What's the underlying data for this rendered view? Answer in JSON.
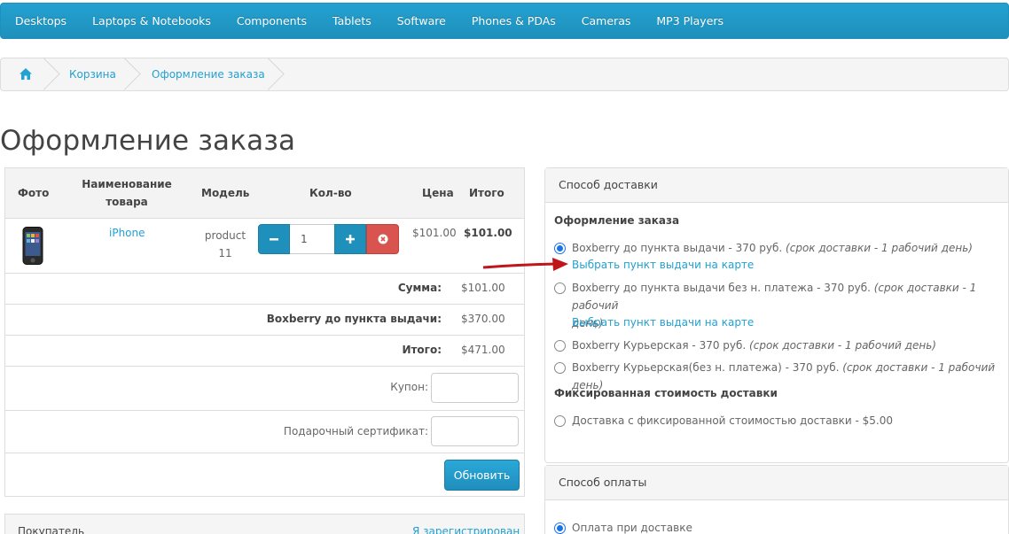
{
  "nav": [
    "Desktops",
    "Laptops & Notebooks",
    "Components",
    "Tablets",
    "Software",
    "Phones & PDAs",
    "Cameras",
    "MP3 Players"
  ],
  "breadcrumb": {
    "home_icon": "home-icon",
    "items": [
      "Корзина",
      "Оформление заказа"
    ]
  },
  "page_title": "Оформление заказа",
  "cart": {
    "headers": {
      "photo": "Фото",
      "name": "Наименование товара",
      "model": "Модель",
      "qty": "Кол-во",
      "price": "Цена",
      "total": "Итого"
    },
    "item": {
      "name": "iPhone",
      "model": "product 11",
      "qty": "1",
      "price": "$101.00",
      "total": "$101.00"
    },
    "summary": [
      {
        "label": "Сумма:",
        "value": "$101.00"
      },
      {
        "label": "Boxberry до пункта выдачи:",
        "value": "$370.00"
      },
      {
        "label": "Итого:",
        "value": "$471.00"
      }
    ],
    "coupon_label": "Купон:",
    "gift_label": "Подарочный сертификат:",
    "update_button": "Обновить"
  },
  "buyer_panel": {
    "title": "Покупатель",
    "link": "Я зарегистрирован"
  },
  "delivery": {
    "title": "Способ доставки",
    "section1": "Оформление заказа",
    "options": [
      {
        "text": "Boxberry до пункта выдачи - 370 руб. ",
        "note": "(срок доставки - 1 рабочий день)",
        "selected": true
      },
      {
        "text": "Boxberry до пункта выдачи без н. платежа - 370 руб. ",
        "note": "(срок доставки - 1 рабочий",
        "note2": "день)",
        "selected": false
      },
      {
        "text": "Boxberry Курьерская - 370 руб. ",
        "note": "(срок доставки - 1 рабочий день)",
        "selected": false
      },
      {
        "text": "Boxberry Курьерская(без н. платежа) - 370 руб. ",
        "note": "(срок доставки - 1 рабочий день)",
        "selected": false
      }
    ],
    "map_link": "Выбрать пункт выдачи на карте",
    "section2": "Фиксированная стоимость доставки",
    "fixed_option": "Доставка с фиксированной стоимостью доставки - $5.00"
  },
  "payment": {
    "title": "Способ оплаты",
    "option": "Оплата при доставке"
  },
  "colors": {
    "brand": "#23a1d1",
    "danger": "#d9534f",
    "arrow": "#c0151b"
  }
}
